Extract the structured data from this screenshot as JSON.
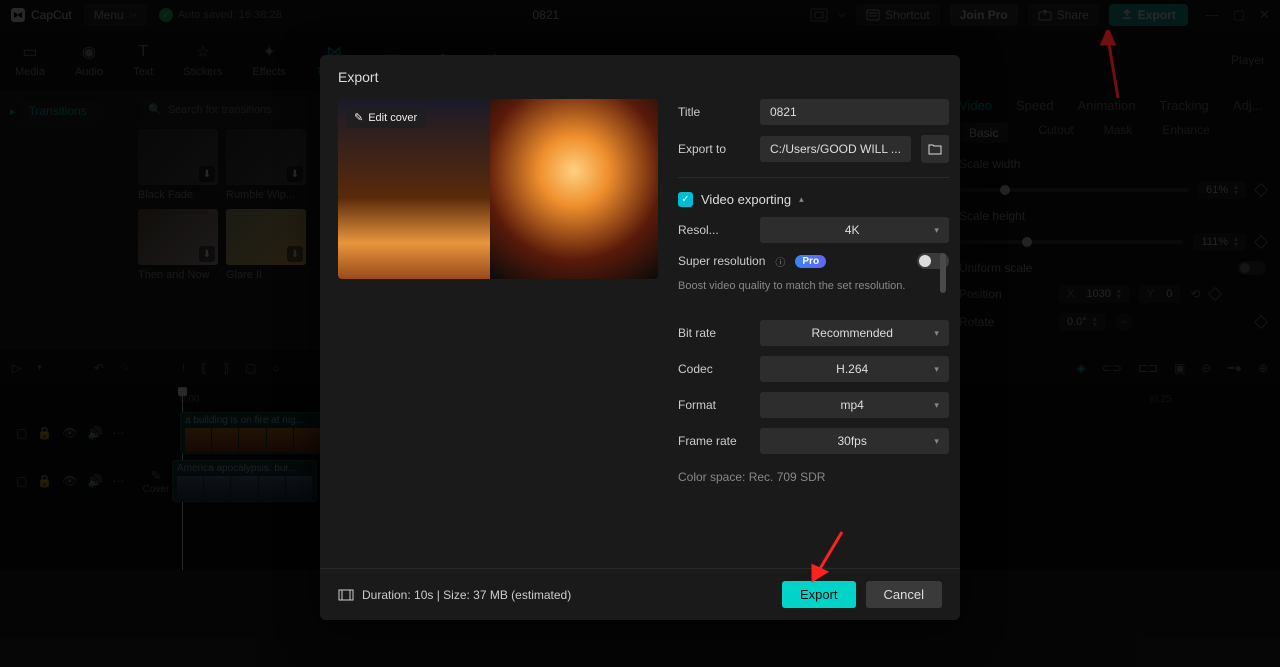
{
  "topbar": {
    "app_name": "CapCut",
    "menu_label": "Menu",
    "autosaved": "Auto saved: 16:38:28",
    "project_title": "0821",
    "shortcut": "Shortcut",
    "join_pro": "Join Pro",
    "share": "Share",
    "export": "Export"
  },
  "tools": {
    "media": "Media",
    "audio": "Audio",
    "text": "Text",
    "stickers": "Stickers",
    "effects": "Effects",
    "transitions": "Trans..."
  },
  "sidebar": {
    "transitions": "Transitions"
  },
  "search": {
    "placeholder": "Search for transitions"
  },
  "thumbs": {
    "r1a": "Black Fade",
    "r1b": "Rumble Wip...",
    "r2a": "Then and Now",
    "r2b": "Glare II"
  },
  "player_label": "Player",
  "right_tabs": {
    "video": "Video",
    "speed": "Speed",
    "animation": "Animation",
    "tracking": "Tracking",
    "adjust": "Adj..."
  },
  "right_subtabs": {
    "basic": "Basic",
    "cutout": "Cutout",
    "mask": "Mask",
    "enhance": "Enhance"
  },
  "props": {
    "scale_w_label": "Scale width",
    "scale_w_val": "61%",
    "scale_h_label": "Scale height",
    "scale_h_val": "111%",
    "uniform_label": "Uniform scale",
    "position_label": "Position",
    "pos_x_label": "X",
    "pos_x_val": "1030",
    "pos_y_label": "Y",
    "pos_y_val": "0",
    "rotate_label": "Rotate",
    "rotate_val": "0.0°"
  },
  "ruler": {
    "t0": "0:00",
    "t25": "|0:25"
  },
  "tracks": {
    "cover": "Cover",
    "clip1": "a building is on fire at nig...",
    "clip2": "America apocalypsis. bur..."
  },
  "modal": {
    "title": "Export",
    "edit_cover": "Edit cover",
    "title_label": "Title",
    "title_value": "0821",
    "exportto_label": "Export to",
    "exportto_value": "C:/Users/GOOD WILL ...",
    "section": "Video exporting",
    "resol_label": "Resol...",
    "resol_value": "4K",
    "super_label": "Super resolution",
    "pro": "Pro",
    "super_help": "Boost video quality to match the set resolution.",
    "bitrate_label": "Bit rate",
    "bitrate_value": "Recommended",
    "codec_label": "Codec",
    "codec_value": "H.264",
    "format_label": "Format",
    "format_value": "mp4",
    "fps_label": "Frame rate",
    "fps_value": "30fps",
    "colorspace": "Color space: Rec. 709 SDR",
    "duration": "Duration: 10s | Size: 37 MB (estimated)",
    "export_btn": "Export",
    "cancel_btn": "Cancel"
  }
}
